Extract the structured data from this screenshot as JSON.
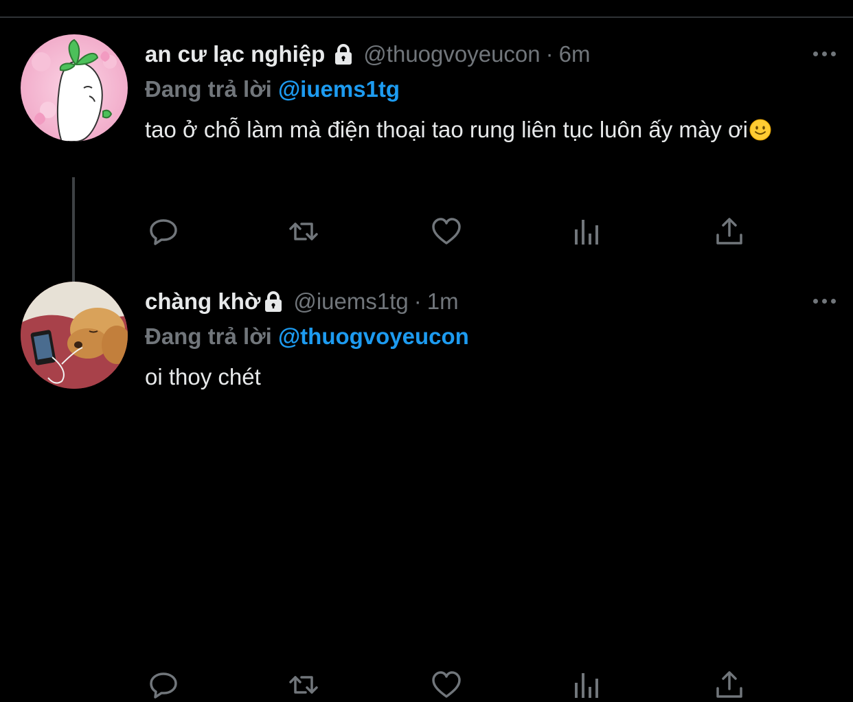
{
  "tweets": [
    {
      "display_name": "an cư lạc nghiệp",
      "handle": "@thuogvoyeucon",
      "separator": "·",
      "time": "6m",
      "replying_prefix": "Đang trả lời",
      "replying_to": "@iuems1tg",
      "text": "tao ở chỗ làm mà điện thoại tao rung liên tục luôn ấy mày ơi"
    },
    {
      "display_name": "chàng khờ",
      "handle": "@iuems1tg",
      "separator": "·",
      "time": "1m",
      "replying_prefix": "Đang trả lời",
      "replying_to": "@thuogvoyeucon",
      "text": "oi thoy chét"
    }
  ],
  "icons": {
    "lock": "lock-icon",
    "more": "more-icon",
    "reply": "reply-icon",
    "retweet": "retweet-icon",
    "like": "like-icon",
    "views": "views-icon",
    "share": "share-icon",
    "emoji": "slightly-smiling-face-emoji"
  },
  "colors": {
    "background": "#000000",
    "text": "#e7e9ea",
    "secondary": "#71767b",
    "mention": "#1d9bf0",
    "thread_line": "#3e4144"
  }
}
